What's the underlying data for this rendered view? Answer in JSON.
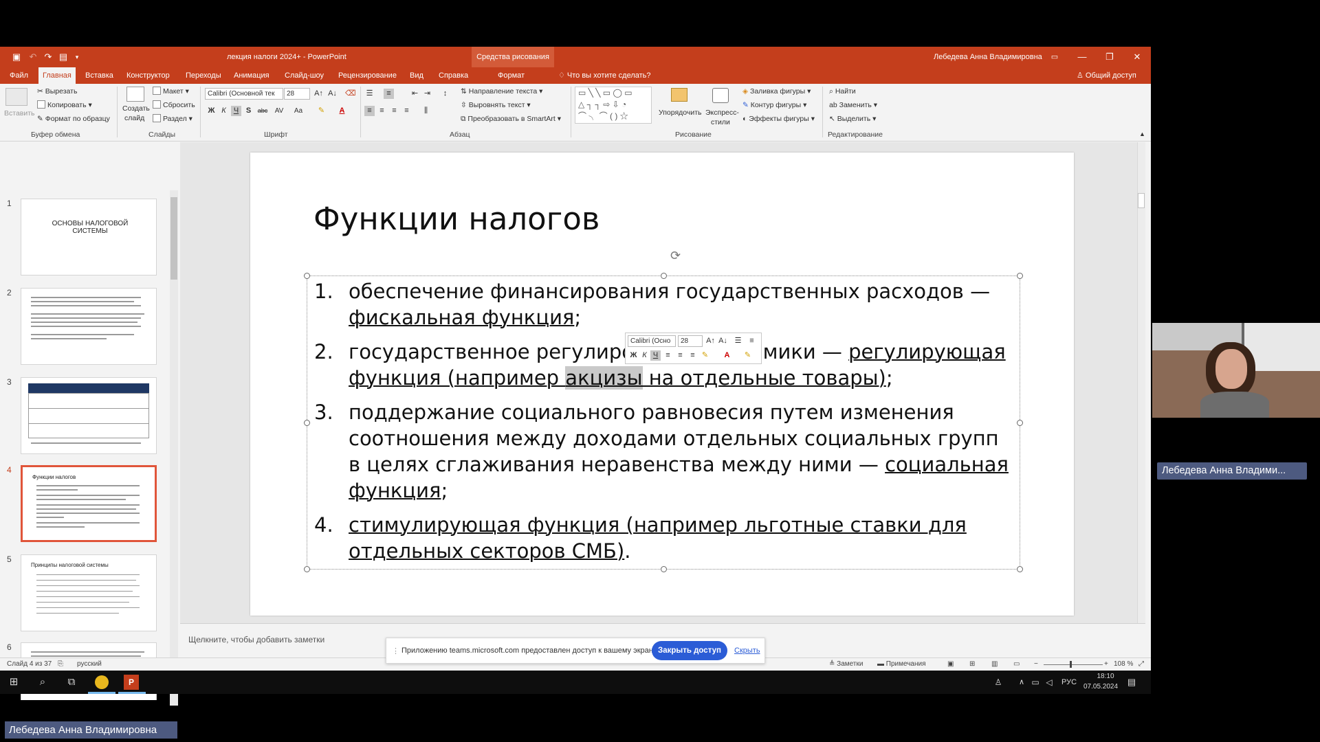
{
  "titlebar": {
    "doc_title": "лекция налоги 2024+ - PowerPoint",
    "context_group": "Средства рисования",
    "user": "Лебедева Анна Владимировна"
  },
  "ribbon_tabs": [
    "Файл",
    "Главная",
    "Вставка",
    "Конструктор",
    "Переходы",
    "Анимация",
    "Слайд-шоу",
    "Рецензирование",
    "Вид",
    "Справка",
    "Формат"
  ],
  "tell_me": "Что вы хотите сделать?",
  "share": "Общий доступ",
  "ribbon": {
    "clipboard": {
      "paste": "Вставить",
      "cut": "Вырезать",
      "copy": "Копировать",
      "format_painter": "Формат по образцу",
      "label": "Буфер обмена"
    },
    "slides": {
      "new_slide_1": "Создать",
      "new_slide_2": "слайд",
      "layout": "Макет",
      "reset": "Сбросить",
      "section": "Раздел",
      "label": "Слайды"
    },
    "font": {
      "family": "Calibri (Основной тек",
      "size": "28",
      "bold": "Ж",
      "italic": "К",
      "underline": "Ч",
      "shadow": "S",
      "strike": "abc",
      "spacing": "AV",
      "case": "Aa",
      "label": "Шрифт"
    },
    "paragraph": {
      "direction": "Направление текста",
      "align": "Выровнять текст",
      "smartart": "Преобразовать в SmartArt",
      "label": "Абзац"
    },
    "drawing": {
      "arrange_1": "Упорядочить",
      "styles_1": "Экспресс-",
      "styles_2": "стили",
      "fill": "Заливка фигуры",
      "outline": "Контур фигуры",
      "effects": "Эффекты фигуры",
      "label": "Рисование"
    },
    "editing": {
      "find": "Найти",
      "replace": "Заменить",
      "select": "Выделить",
      "label": "Редактирование"
    }
  },
  "thumbnails": [
    {
      "num": "1",
      "title": "ОСНОВЫ НАЛОГОВОЙ СИСТЕМЫ"
    },
    {
      "num": "2",
      "title": ""
    },
    {
      "num": "3",
      "title": ""
    },
    {
      "num": "4",
      "title": "Функции налогов"
    },
    {
      "num": "5",
      "title": "Принципы налоговой системы"
    },
    {
      "num": "6",
      "title": ""
    }
  ],
  "slide": {
    "title": "Функции налогов",
    "bullets": [
      {
        "num": "1.",
        "a": "обеспечение финансирования государственных расходов — ",
        "b": "фискальная функция",
        "c": ";"
      },
      {
        "num": "2.",
        "a": "государственное регулирование экономики — ",
        "b1": "регулирующая функция (например ",
        "b2": "акцизы",
        "b3": " на отдельные товары)",
        "c": ";"
      },
      {
        "num": "3.",
        "a": "поддержание социального равновесия путем изменения соотношения между доходами отдельных социальных групп в целях сглаживания неравенства между ними — ",
        "b": "социальная функция",
        "c": ";"
      },
      {
        "num": "4.",
        "a": "",
        "b": "стимулирующая функция (например льготные ставки для отдельных секторов СМБ)",
        "c": "."
      }
    ]
  },
  "mini_toolbar": {
    "font": "Calibri (Осно",
    "size": "28"
  },
  "notes_placeholder": "Щелкните, чтобы добавить заметки",
  "status": {
    "slide_info": "Слайд 4 из 37",
    "language": "русский",
    "notes": "Заметки",
    "comments": "Примечания",
    "zoom": "108 %"
  },
  "share_banner": {
    "message": "Приложению teams.microsoft.com предоставлен доступ к вашему экрану.",
    "stop": "Закрыть доступ",
    "hide": "Скрыть"
  },
  "taskbar": {
    "lang": "РУС",
    "time": "18:10",
    "date": "07.05.2024"
  },
  "meeting": {
    "presenter_short": "Лебедева Анна Владими...",
    "presenter_full": "Лебедева Анна Владимировна"
  },
  "colors": {
    "accent": "#c43e1c",
    "context": "#d35b39",
    "badge": "#4d5a80",
    "teams_blue": "#2b5cd6"
  }
}
